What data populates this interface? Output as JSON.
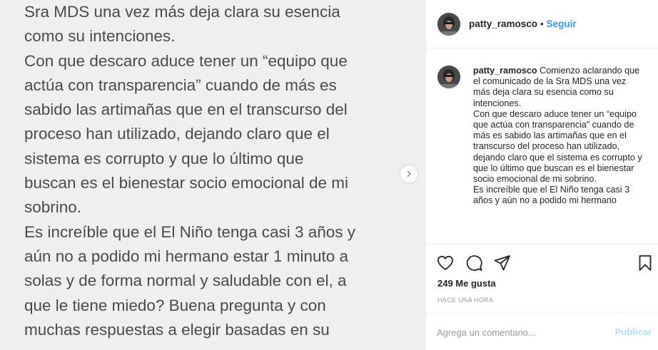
{
  "post": {
    "image_lines": [
      "Sra MDS una vez más deja clara su esencia",
      "como su intenciones.",
      "Con que descaro aduce tener un “equipo que",
      "actúa con transparencia” cuando de más es",
      "sabido las artimañas que en el transcurso del",
      "proceso han utilizado, dejando claro que el",
      "sistema es corrupto y que lo último que",
      "buscan es el bienestar socio emocional de mi",
      "sobrino.",
      "Es increíble que el El Niño tenga casi 3 años y",
      "aún no a podido mi hermano estar 1 minuto a",
      "solas y de forma normal y saludable con el, a",
      "que le tiene miedo? Buena pregunta y con",
      "muchas respuestas a elegir basadas en su"
    ]
  },
  "header": {
    "username": "patty_ramosco",
    "separator": "•",
    "follow_label": "Seguir"
  },
  "caption": {
    "username": "patty_ramosco",
    "text": " Comienzo aclarando que el comunicado de la Sra MDS una vez más deja clara su esencia como su intenciones.\nCon que descaro aduce tener un “equipo que actúa con transparencia” cuando de más es sabido las artimañas que en el transcurso del proceso han utilizado, dejando claro que el sistema es corrupto y que lo último que buscan es el bienestar socio emocional de mi sobrino.\nEs increíble que el El Niño tenga casi 3 años y aún no a podido mi hermano"
  },
  "engagement": {
    "likes": "249 Me gusta",
    "timestamp": "HACE UNA HORA"
  },
  "comment_box": {
    "placeholder": "Agrega un comentario...",
    "publish_label": "Publicar"
  },
  "icons": {
    "like": "heart-icon",
    "comment": "speech-bubble-icon",
    "share": "paper-plane-icon",
    "save": "bookmark-icon",
    "next": "chevron-right-icon"
  },
  "colors": {
    "link": "#3897f0",
    "publish_disabled": "#b2dffc",
    "image_background": "#efefef",
    "image_text": "#4a4a4a"
  }
}
